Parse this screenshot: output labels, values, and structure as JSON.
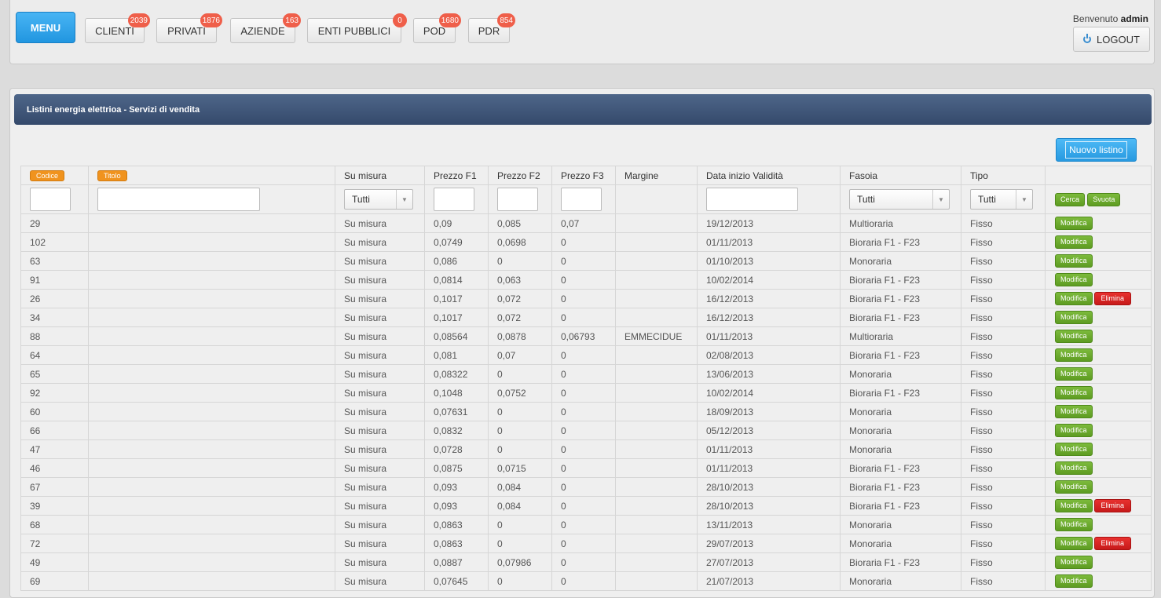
{
  "header": {
    "menu_label": "MENU",
    "nav": [
      {
        "label": "CLIENTI",
        "badge": "2039"
      },
      {
        "label": "PRIVATI",
        "badge": "1876"
      },
      {
        "label": "AZIENDE",
        "badge": "163"
      },
      {
        "label": "ENTI PUBBLICI",
        "badge": "0"
      },
      {
        "label": "POD",
        "badge": "1680"
      },
      {
        "label": "PDR",
        "badge": "854"
      }
    ],
    "welcome_prefix": "Benvenuto",
    "username": "admin",
    "logout_label": "LOGOUT"
  },
  "panel": {
    "title": "Listini energia elettrioa - Servizi di vendita",
    "new_button": "Nuovo listino"
  },
  "table": {
    "columns": [
      "Codice",
      "Titolo",
      "Su misura",
      "Prezzo F1",
      "Prezzo F2",
      "Prezzo F3",
      "Margine",
      "Data inizio Validità",
      "Fasoia",
      "Tipo"
    ],
    "filters": {
      "su_misura": "Tutti",
      "fascia": "Tutti",
      "tipo": "Tutti",
      "search_label": "Cerca",
      "clear_label": "Svuota"
    },
    "edit_label": "Modifica",
    "delete_label": "Elimina",
    "rows": [
      {
        "codice": "29",
        "titolo": "",
        "su_misura": "Su misura",
        "f1": "0,09",
        "f2": "0,085",
        "f3": "0,07",
        "margine": "",
        "data": "19/12/2013",
        "fascia": "Multioraria",
        "tipo": "Fisso",
        "deletable": false
      },
      {
        "codice": "102",
        "titolo": "",
        "su_misura": "Su misura",
        "f1": "0,0749",
        "f2": "0,0698",
        "f3": "0",
        "margine": "",
        "data": "01/11/2013",
        "fascia": "Bioraria F1 - F23",
        "tipo": "Fisso",
        "deletable": false
      },
      {
        "codice": "63",
        "titolo": "",
        "su_misura": "Su misura",
        "f1": "0,086",
        "f2": "0",
        "f3": "0",
        "margine": "",
        "data": "01/10/2013",
        "fascia": "Monoraria",
        "tipo": "Fisso",
        "deletable": false
      },
      {
        "codice": "91",
        "titolo": "",
        "su_misura": "Su misura",
        "f1": "0,0814",
        "f2": "0,063",
        "f3": "0",
        "margine": "",
        "data": "10/02/2014",
        "fascia": "Bioraria F1 - F23",
        "tipo": "Fisso",
        "deletable": false
      },
      {
        "codice": "26",
        "titolo": "",
        "su_misura": "Su misura",
        "f1": "0,1017",
        "f2": "0,072",
        "f3": "0",
        "margine": "",
        "data": "16/12/2013",
        "fascia": "Bioraria F1 - F23",
        "tipo": "Fisso",
        "deletable": true
      },
      {
        "codice": "34",
        "titolo": "",
        "su_misura": "Su misura",
        "f1": "0,1017",
        "f2": "0,072",
        "f3": "0",
        "margine": "",
        "data": "16/12/2013",
        "fascia": "Bioraria F1 - F23",
        "tipo": "Fisso",
        "deletable": false
      },
      {
        "codice": "88",
        "titolo": "",
        "su_misura": "Su misura",
        "f1": "0,08564",
        "f2": "0,0878",
        "f3": "0,06793",
        "margine": "EMMECIDUE",
        "data": "01/11/2013",
        "fascia": "Multioraria",
        "tipo": "Fisso",
        "deletable": false
      },
      {
        "codice": "64",
        "titolo": "",
        "su_misura": "Su misura",
        "f1": "0,081",
        "f2": "0,07",
        "f3": "0",
        "margine": "",
        "data": "02/08/2013",
        "fascia": "Bioraria F1 - F23",
        "tipo": "Fisso",
        "deletable": false
      },
      {
        "codice": "65",
        "titolo": "",
        "su_misura": "Su misura",
        "f1": "0,08322",
        "f2": "0",
        "f3": "0",
        "margine": "",
        "data": "13/06/2013",
        "fascia": "Monoraria",
        "tipo": "Fisso",
        "deletable": false
      },
      {
        "codice": "92",
        "titolo": "",
        "su_misura": "Su misura",
        "f1": "0,1048",
        "f2": "0,0752",
        "f3": "0",
        "margine": "",
        "data": "10/02/2014",
        "fascia": "Bioraria F1 - F23",
        "tipo": "Fisso",
        "deletable": false
      },
      {
        "codice": "60",
        "titolo": "",
        "su_misura": "Su misura",
        "f1": "0,07631",
        "f2": "0",
        "f3": "0",
        "margine": "",
        "data": "18/09/2013",
        "fascia": "Monoraria",
        "tipo": "Fisso",
        "deletable": false
      },
      {
        "codice": "66",
        "titolo": "",
        "su_misura": "Su misura",
        "f1": "0,0832",
        "f2": "0",
        "f3": "0",
        "margine": "",
        "data": "05/12/2013",
        "fascia": "Monoraria",
        "tipo": "Fisso",
        "deletable": false
      },
      {
        "codice": "47",
        "titolo": "",
        "su_misura": "Su misura",
        "f1": "0,0728",
        "f2": "0",
        "f3": "0",
        "margine": "",
        "data": "01/11/2013",
        "fascia": "Monoraria",
        "tipo": "Fisso",
        "deletable": false
      },
      {
        "codice": "46",
        "titolo": "",
        "su_misura": "Su misura",
        "f1": "0,0875",
        "f2": "0,0715",
        "f3": "0",
        "margine": "",
        "data": "01/11/2013",
        "fascia": "Bioraria F1 - F23",
        "tipo": "Fisso",
        "deletable": false
      },
      {
        "codice": "67",
        "titolo": "",
        "su_misura": "Su misura",
        "f1": "0,093",
        "f2": "0,084",
        "f3": "0",
        "margine": "",
        "data": "28/10/2013",
        "fascia": "Bioraria F1 - F23",
        "tipo": "Fisso",
        "deletable": false
      },
      {
        "codice": "39",
        "titolo": "",
        "su_misura": "Su misura",
        "f1": "0,093",
        "f2": "0,084",
        "f3": "0",
        "margine": "",
        "data": "28/10/2013",
        "fascia": "Bioraria F1 - F23",
        "tipo": "Fisso",
        "deletable": true
      },
      {
        "codice": "68",
        "titolo": "",
        "su_misura": "Su misura",
        "f1": "0,0863",
        "f2": "0",
        "f3": "0",
        "margine": "",
        "data": "13/11/2013",
        "fascia": "Monoraria",
        "tipo": "Fisso",
        "deletable": false
      },
      {
        "codice": "72",
        "titolo": "",
        "su_misura": "Su misura",
        "f1": "0,0863",
        "f2": "0",
        "f3": "0",
        "margine": "",
        "data": "29/07/2013",
        "fascia": "Monoraria",
        "tipo": "Fisso",
        "deletable": true
      },
      {
        "codice": "49",
        "titolo": "",
        "su_misura": "Su misura",
        "f1": "0,0887",
        "f2": "0,07986",
        "f3": "0",
        "margine": "",
        "data": "27/07/2013",
        "fascia": "Bioraria F1 - F23",
        "tipo": "Fisso",
        "deletable": false
      },
      {
        "codice": "69",
        "titolo": "",
        "su_misura": "Su misura",
        "f1": "0,07645",
        "f2": "0",
        "f3": "0",
        "margine": "",
        "data": "21/07/2013",
        "fascia": "Monoraria",
        "tipo": "Fisso",
        "deletable": false
      }
    ]
  }
}
